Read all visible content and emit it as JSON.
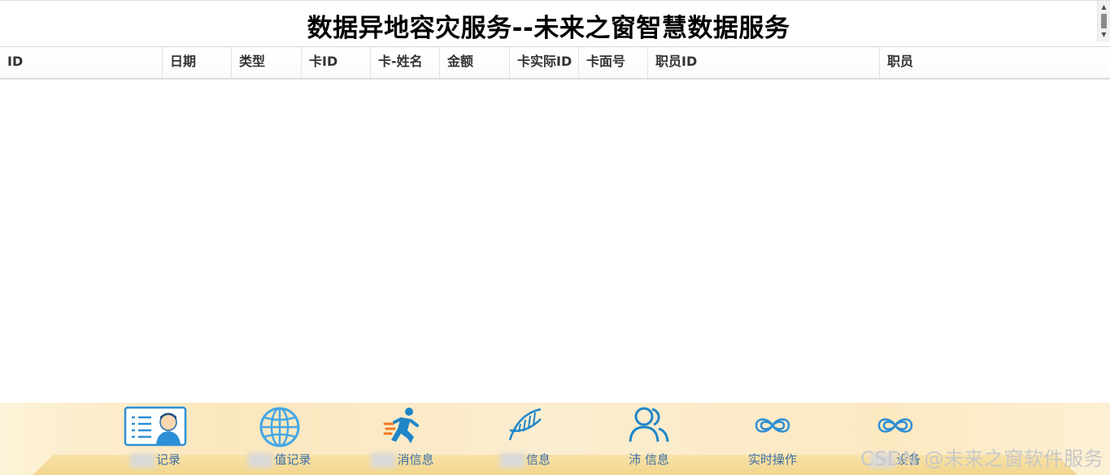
{
  "header": {
    "title": "数据异地容灾服务--未来之窗智慧数据服务"
  },
  "table": {
    "columns": [
      "ID",
      "日期",
      "类型",
      "卡ID",
      "卡-姓名",
      "金额",
      "卡实际ID",
      "卡面号",
      "职员ID",
      "职员"
    ]
  },
  "dock": {
    "items": [
      {
        "label": "记录",
        "icon": "id-card-icon"
      },
      {
        "label": "值记录",
        "icon": "globe-icon"
      },
      {
        "label": "消信息",
        "icon": "running-man-icon"
      },
      {
        "label": "信息",
        "icon": "dna-icon"
      },
      {
        "label": "沛 信息",
        "icon": "users-icon"
      },
      {
        "label": "实时操作",
        "icon": "infinity-icon"
      },
      {
        "label": "设备",
        "icon": "infinity-icon"
      }
    ]
  },
  "watermark": "CSDN @未来之窗软件服务"
}
